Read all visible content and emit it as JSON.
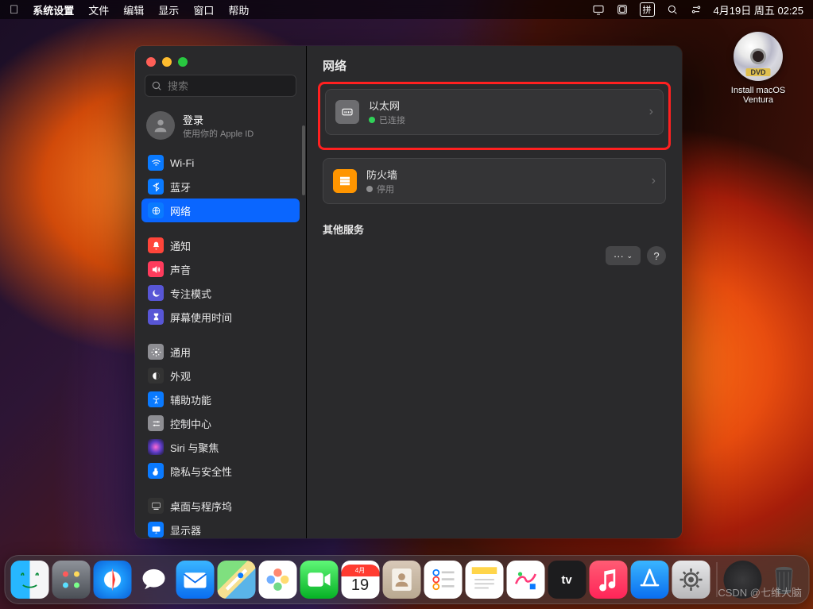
{
  "menubar": {
    "app": "系统设置",
    "items": [
      "文件",
      "编辑",
      "显示",
      "窗口",
      "帮助"
    ],
    "input_method": "拼",
    "datetime": "4月19日 周五  02:25"
  },
  "desktop": {
    "dvd_badge": "DVD",
    "install_label": "Install macOS Ventura"
  },
  "window": {
    "search_placeholder": "搜索",
    "account": {
      "title": "登录",
      "subtitle": "使用你的 Apple ID"
    },
    "sidebar_group1": [
      {
        "id": "wifi",
        "label": "Wi-Fi"
      },
      {
        "id": "bluetooth",
        "label": "蓝牙"
      },
      {
        "id": "network",
        "label": "网络",
        "selected": true
      }
    ],
    "sidebar_group2": [
      {
        "id": "notifications",
        "label": "通知"
      },
      {
        "id": "sound",
        "label": "声音"
      },
      {
        "id": "focus",
        "label": "专注模式"
      },
      {
        "id": "screentime",
        "label": "屏幕使用时间"
      }
    ],
    "sidebar_group3": [
      {
        "id": "general",
        "label": "通用"
      },
      {
        "id": "appearance",
        "label": "外观"
      },
      {
        "id": "accessibility",
        "label": "辅助功能"
      },
      {
        "id": "controlcenter",
        "label": "控制中心"
      },
      {
        "id": "siri",
        "label": "Siri 与聚焦"
      },
      {
        "id": "privacy",
        "label": "隐私与安全性"
      }
    ],
    "sidebar_group4": [
      {
        "id": "desktopdock",
        "label": "桌面与程序坞"
      },
      {
        "id": "displays",
        "label": "显示器"
      }
    ],
    "content": {
      "title": "网络",
      "ethernet": {
        "label": "以太网",
        "status": "已连接"
      },
      "firewall": {
        "label": "防火墙",
        "status": "停用"
      },
      "other_services": "其他服务",
      "more": "···",
      "help": "?"
    }
  },
  "dock_items": [
    "finder",
    "launchpad",
    "safari",
    "messages",
    "mail",
    "maps",
    "photos",
    "facetime",
    "calendar",
    "contacts",
    "reminders",
    "notes",
    "freeform",
    "tv",
    "music",
    "appstore",
    "settings"
  ],
  "calendar_day": "19",
  "watermark": "CSDN @七维大脑"
}
